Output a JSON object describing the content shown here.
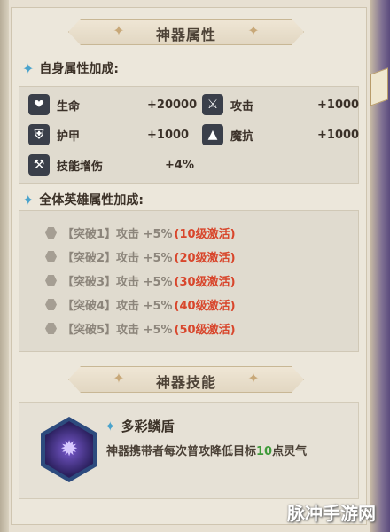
{
  "artifact_banner": {
    "title": "神器属性"
  },
  "self_section": {
    "title": "自身属性加成:",
    "stats": [
      {
        "name": "生命",
        "value": "+20000",
        "icon": "heart-icon",
        "glyph": "❤"
      },
      {
        "name": "攻击",
        "value": "+1000",
        "icon": "sword-icon",
        "glyph": "⚔"
      },
      {
        "name": "护甲",
        "value": "+1000",
        "icon": "armor-icon",
        "glyph": "⛨"
      },
      {
        "name": "魔抗",
        "value": "+1000",
        "icon": "wizard-hat-icon",
        "glyph": "▲"
      },
      {
        "name": "技能增伤",
        "value": "+4%",
        "icon": "hammer-icon",
        "glyph": "⚒"
      }
    ]
  },
  "team_section": {
    "title": "全体英雄属性加成:",
    "rows": [
      {
        "text": "【突破1】攻击 +5%",
        "cond": "(10级激活)"
      },
      {
        "text": "【突破2】攻击 +5%",
        "cond": "(20级激活)"
      },
      {
        "text": "【突破3】攻击 +5%",
        "cond": "(30级激活)"
      },
      {
        "text": "【突破4】攻击 +5%",
        "cond": "(40级激活)"
      },
      {
        "text": "【突破5】攻击 +5%",
        "cond": "(50级激活)"
      }
    ]
  },
  "skill_banner": {
    "title": "神器技能"
  },
  "skill": {
    "name": "多彩鳞盾",
    "desc_pre": "神器携带者每次普攻降低目标",
    "desc_num": "10",
    "desc_post": "点灵气"
  },
  "watermark": "脉冲手游网",
  "colors": {
    "accent_blue": "#4aa3cc",
    "condition_red": "#d8462c",
    "highlight_green": "#3f9a3a"
  }
}
